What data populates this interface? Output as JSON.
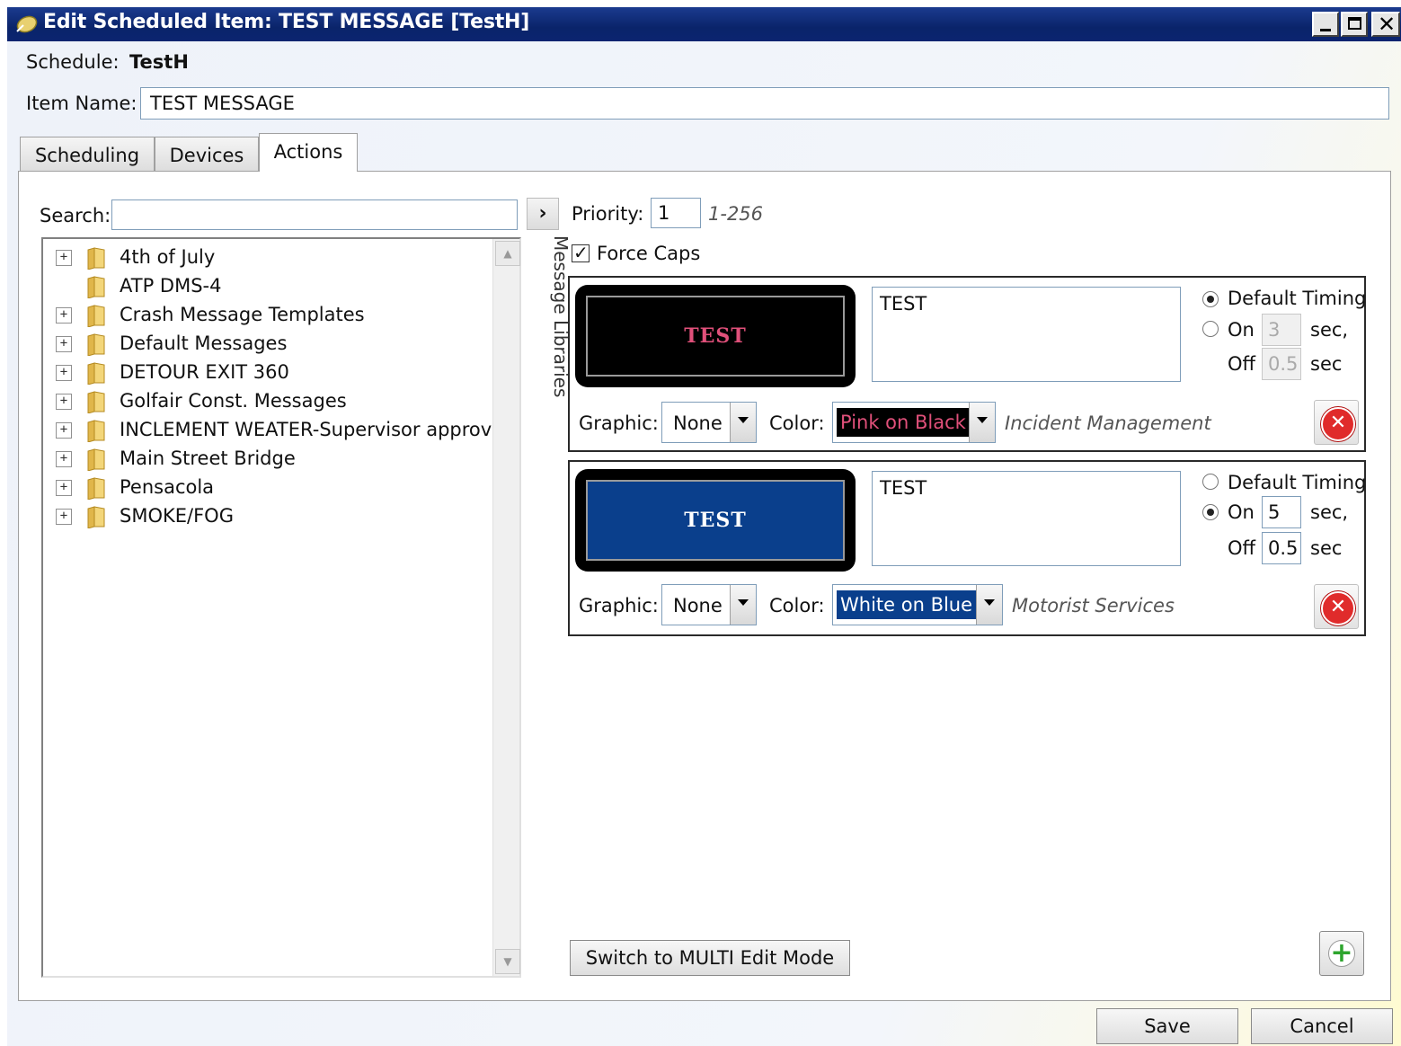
{
  "window": {
    "title": "Edit Scheduled Item: TEST MESSAGE [TestH]"
  },
  "header": {
    "schedule_label": "Schedule:",
    "schedule_value": "TestH",
    "item_name_label": "Item Name:",
    "item_name_value": "TEST MESSAGE"
  },
  "tabs": [
    {
      "label": "Scheduling",
      "active": false
    },
    {
      "label": "Devices",
      "active": false
    },
    {
      "label": "Actions",
      "active": true
    }
  ],
  "library": {
    "search_label": "Search:",
    "search_value": "",
    "side_label": "Message Libraries",
    "items": [
      {
        "label": "4th of July",
        "expandable": true
      },
      {
        "label": "ATP DMS-4",
        "expandable": false
      },
      {
        "label": "Crash Message Templates",
        "expandable": true
      },
      {
        "label": "Default Messages",
        "expandable": true
      },
      {
        "label": "DETOUR EXIT 360",
        "expandable": true
      },
      {
        "label": "Golfair Const. Messages",
        "expandable": true
      },
      {
        "label": "INCLEMENT WEATER-Supervisor approval",
        "expandable": true
      },
      {
        "label": "Main Street Bridge",
        "expandable": true
      },
      {
        "label": "Pensacola",
        "expandable": true
      },
      {
        "label": "SMOKE/FOG",
        "expandable": true
      }
    ]
  },
  "actions": {
    "priority_label": "Priority:",
    "priority_value": "1",
    "priority_range": "1-256",
    "force_caps_label": "Force Caps",
    "force_caps_checked": true,
    "graphic_label": "Graphic:",
    "color_label": "Color:",
    "default_timing_label": "Default Timing",
    "on_label": "On",
    "off_label": "Off",
    "sec_comma": "sec,",
    "sec": "sec",
    "messages": [
      {
        "preview_text": "TEST",
        "message_text": "TEST",
        "sign_bg": "#000000",
        "sign_fg": "#e0507a",
        "graphic": "None",
        "color_option": "Pink on Black",
        "color_option_bg": "#000000",
        "color_option_fg": "#e0507a",
        "category": "Incident Management",
        "default_timing": true,
        "on_sec": "3",
        "off_sec": "0.5"
      },
      {
        "preview_text": "TEST",
        "message_text": "TEST",
        "sign_bg": "#0a3f8c",
        "sign_fg": "#ffffff",
        "graphic": "None",
        "color_option": "White on Blue",
        "color_option_bg": "#0a3f8c",
        "color_option_fg": "#ffffff",
        "category": "Motorist Services",
        "default_timing": false,
        "on_sec": "5",
        "off_sec": "0.5"
      }
    ],
    "switch_mode_label": "Switch to MULTI Edit Mode"
  },
  "footer": {
    "save_label": "Save",
    "cancel_label": "Cancel"
  }
}
